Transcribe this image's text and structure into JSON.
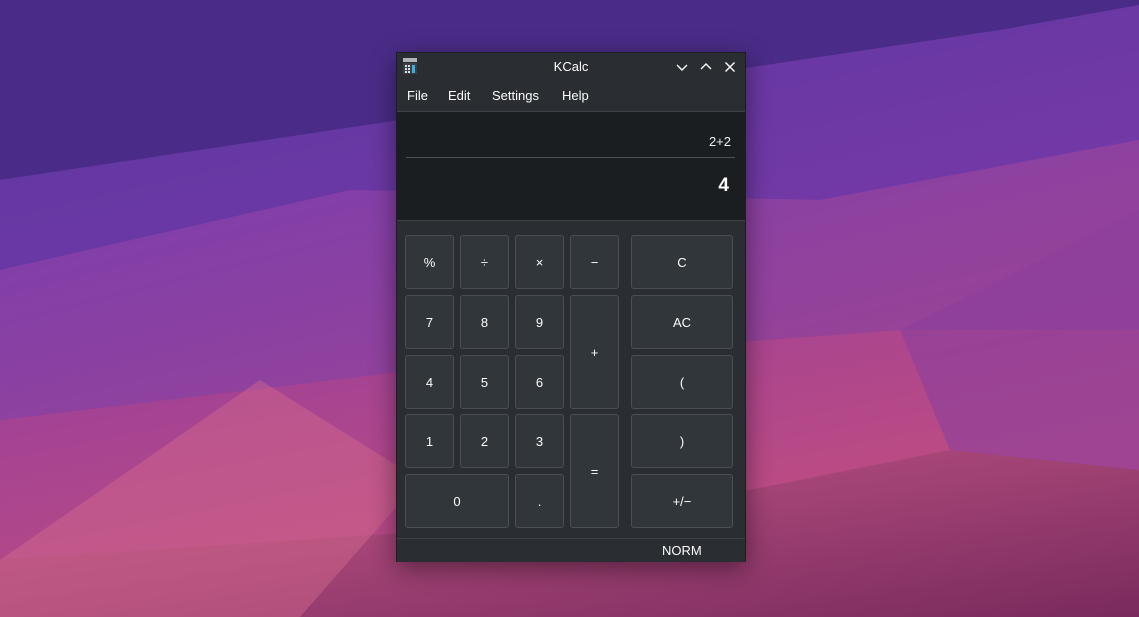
{
  "window": {
    "title": "KCalc",
    "controls": {
      "minimize_icon": "chevron-down-icon",
      "maximize_icon": "chevron-up-icon",
      "close_icon": "close-icon"
    }
  },
  "menu": [
    "File",
    "Edit",
    "Settings",
    "Help"
  ],
  "display": {
    "expression": "2+2",
    "result": "4"
  },
  "keys": {
    "percent": "%",
    "divide": "÷",
    "multiply": "×",
    "minus": "−",
    "clear": "C",
    "seven": "7",
    "eight": "8",
    "nine": "9",
    "plus": "+",
    "all_clear": "AC",
    "four": "4",
    "five": "5",
    "six": "6",
    "open_paren": "(",
    "one": "1",
    "two": "2",
    "three": "3",
    "equals": "=",
    "close_paren": ")",
    "zero": "0",
    "decimal": ".",
    "sign": "+/−"
  },
  "status": {
    "mode": "NORM"
  },
  "colors": {
    "window_bg": "#2a2e32",
    "display_bg": "#1b1e20",
    "key_bg": "#31363b",
    "key_border": "#4a4f55",
    "text": "#fcfcfc"
  }
}
